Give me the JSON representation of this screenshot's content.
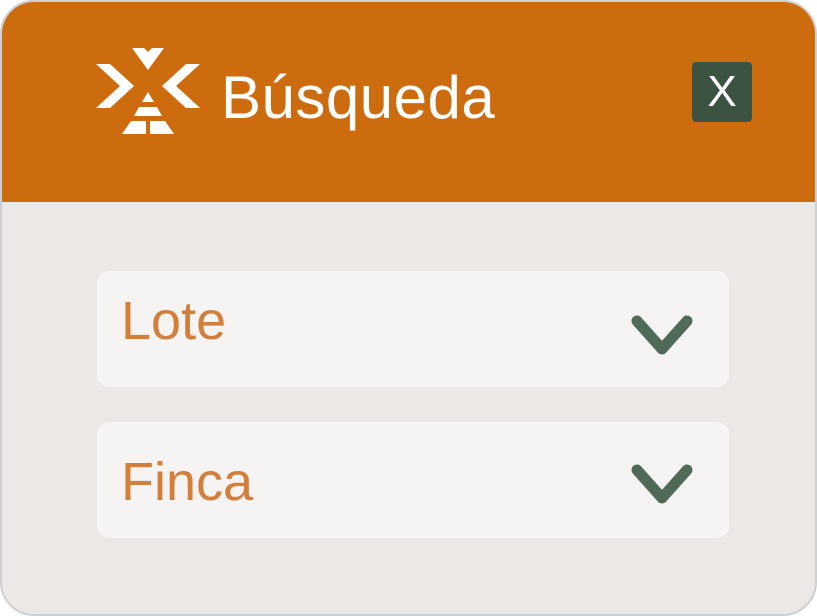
{
  "dialog": {
    "title": "Búsqueda",
    "close_label": "X",
    "colors": {
      "header": "#cd6c0f",
      "body": "#ebe8e5",
      "close_button": "#3b5340",
      "field_text": "#d37e3b",
      "chevron": "#4f6a57"
    }
  },
  "fields": [
    {
      "label": "Lote",
      "icon": "chevron-down-icon"
    },
    {
      "label": "Finca",
      "icon": "chevron-down-icon"
    }
  ]
}
